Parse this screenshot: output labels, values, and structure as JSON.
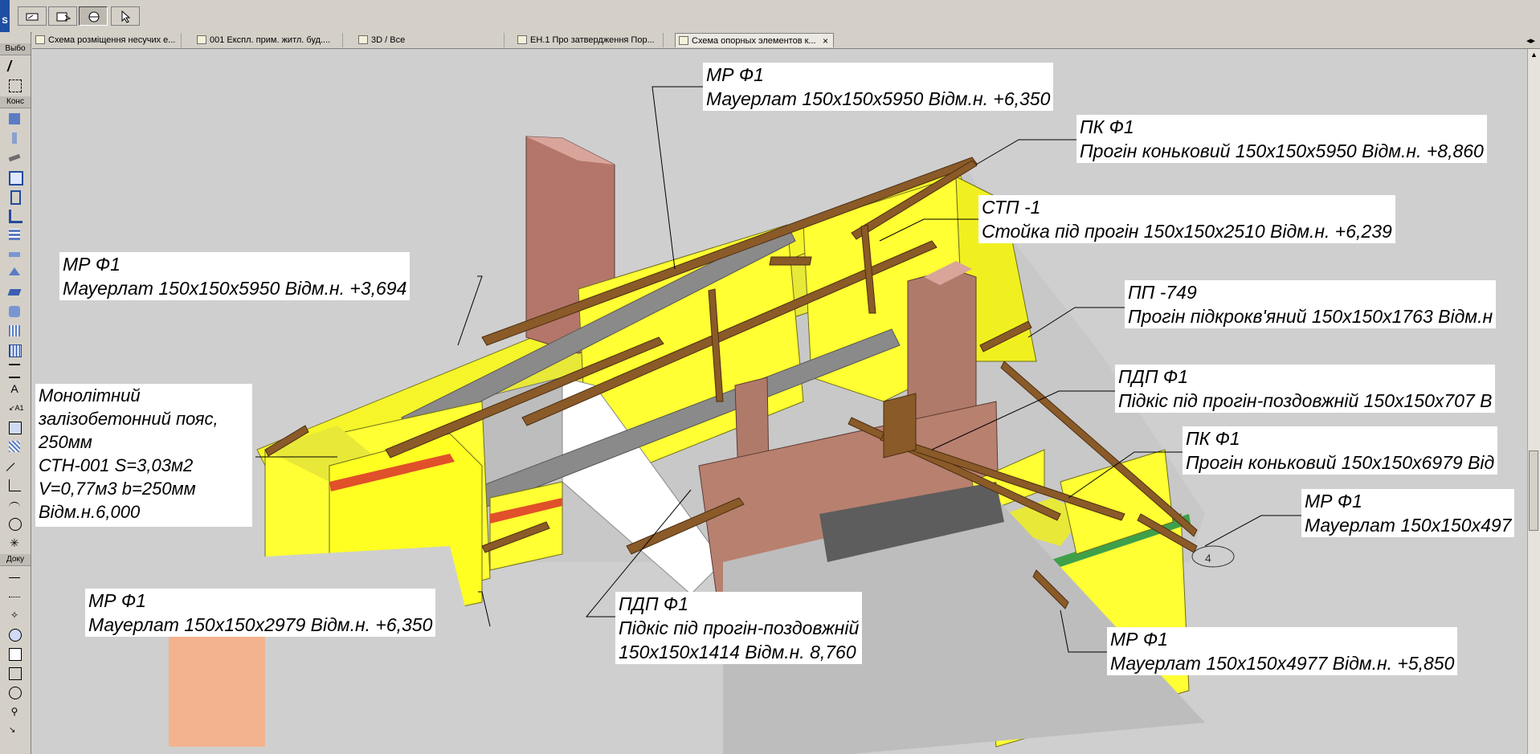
{
  "app": {
    "logo_letter": "S"
  },
  "toolbar": {
    "buttons": [
      {
        "name": "pick-up-params",
        "icon": "eyedropper-icon"
      },
      {
        "name": "marquee",
        "icon": "marquee-icon"
      },
      {
        "name": "orbit",
        "icon": "orbit-icon"
      },
      {
        "name": "arrow",
        "icon": "arrow-cursor-icon"
      }
    ]
  },
  "tabs": [
    {
      "label": "Схема розміщення несучих е...",
      "icon": "folder-icon",
      "active": false
    },
    {
      "label": "001 Експл. прим. житл. буд....",
      "icon": "table-icon",
      "active": false
    },
    {
      "label": "3D / Все",
      "icon": "cube-icon",
      "active": false
    },
    {
      "label": "ЕН.1 Про затвердження Пор...",
      "icon": "folder-icon",
      "active": false
    },
    {
      "label": "Схема опорных элементов к...",
      "icon": "layout-icon",
      "active": true
    }
  ],
  "tab_close": "×",
  "tab_scroll": "◂▸",
  "toolbox": {
    "select_header": "Выбо",
    "construct_header": "Конс",
    "document_header": "Доку"
  },
  "labels": [
    {
      "id": "mr1",
      "line1": "МР  Ф1",
      "line2": "Мауерлат 150х150х5950 Відм.н. +6,350"
    },
    {
      "id": "pk1",
      "line1": "ПК  Ф1",
      "line2": "Прогін коньковий 150х150х5950 Відм.н. +8,860"
    },
    {
      "id": "stp",
      "line1": "СТП  -1",
      "line2": "Стойка під прогін 150х150х2510 Відм.н. +6,239"
    },
    {
      "id": "mr2",
      "line1": "МР  Ф1",
      "line2": "Мауерлат 150х150х5950 Відм.н. +3,694"
    },
    {
      "id": "pp",
      "line1": "ПП  -749",
      "line2": "Прогін підкрокв'яний 150х150х1763 Відм.н"
    },
    {
      "id": "pdp1",
      "line1": "ПДП  Ф1",
      "line2": "Підкіс під прогін-поздовжній 150х150х707 В"
    },
    {
      "id": "pk2",
      "line1": "ПК  Ф1",
      "line2": "Прогін коньковий 150х150х6979 Від"
    },
    {
      "id": "mr3",
      "line1": "МР  Ф1",
      "line2": "Мауерлат 150х150х497"
    },
    {
      "id": "mr4",
      "line1": "МР  Ф1",
      "line2": "Мауерлат 150х150х2979 Відм.н. +6,350"
    },
    {
      "id": "pdp2",
      "line1": "ПДП  Ф1",
      "line2": "Підкіс під прогін-поздовжній",
      "line3": "150х150х1414 Відм.н. 8,760"
    },
    {
      "id": "mr5",
      "line1": "МР  Ф1",
      "line2": "Мауерлат 150х150х4977 Відм.н. +5,850"
    }
  ],
  "monolith": {
    "lines": [
      "   Монолітний",
      "залізобетонний пояс,",
      "250мм",
      " СТН-001 S=3,03м2",
      "V=0,77м3 b=250мм",
      "Відм.н.6,000"
    ]
  },
  "marker": "4",
  "colors": {
    "wall_yellow": "#ffff33",
    "wall_pink": "#b07a6a",
    "timber": "#8a5a28",
    "slab_grey": "#8e8e8e",
    "red_band": "#e0502a",
    "green_band": "#3fa04a"
  }
}
